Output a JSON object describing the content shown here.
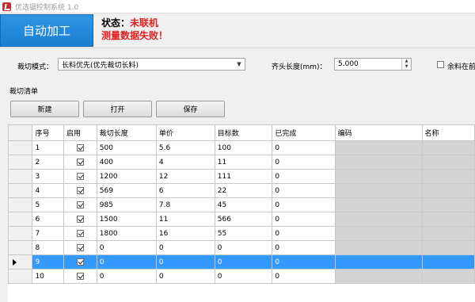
{
  "window": {
    "title": "优选锯控制系统 1.0"
  },
  "header": {
    "mode": "自动加工",
    "status_label": "状态：",
    "status_value": "未联机",
    "status_message": "测量数据失败！"
  },
  "config": {
    "cut_mode_label": "裁切模式：",
    "cut_mode_value": "长料优先(优先裁切长料)",
    "head_length_label": "齐头长度(mm)：",
    "head_length_value": "5.000",
    "remainder_label": "余料在前"
  },
  "cut_list": {
    "title": "裁切清单",
    "buttons": {
      "new": "新建",
      "open": "打开",
      "save": "保存"
    },
    "columns": [
      "序号",
      "启用",
      "裁切长度",
      "单价",
      "目标数",
      "已完成",
      "编码",
      "名称"
    ],
    "selected_index": 8,
    "rows": [
      {
        "seq": "1",
        "enabled": true,
        "length": "500",
        "price": "5.6",
        "target": "100",
        "done": "0",
        "code": "",
        "name": ""
      },
      {
        "seq": "2",
        "enabled": true,
        "length": "400",
        "price": "4",
        "target": "11",
        "done": "0",
        "code": "",
        "name": ""
      },
      {
        "seq": "3",
        "enabled": true,
        "length": "1200",
        "price": "12",
        "target": "111",
        "done": "0",
        "code": "",
        "name": ""
      },
      {
        "seq": "4",
        "enabled": true,
        "length": "569",
        "price": "6",
        "target": "22",
        "done": "0",
        "code": "",
        "name": ""
      },
      {
        "seq": "5",
        "enabled": true,
        "length": "985",
        "price": "7.8",
        "target": "45",
        "done": "0",
        "code": "",
        "name": ""
      },
      {
        "seq": "6",
        "enabled": true,
        "length": "1500",
        "price": "11",
        "target": "566",
        "done": "0",
        "code": "",
        "name": ""
      },
      {
        "seq": "7",
        "enabled": true,
        "length": "1800",
        "price": "16",
        "target": "55",
        "done": "0",
        "code": "",
        "name": ""
      },
      {
        "seq": "8",
        "enabled": true,
        "length": "0",
        "price": "0",
        "target": "0",
        "done": "0",
        "code": "",
        "name": ""
      },
      {
        "seq": "9",
        "enabled": true,
        "length": "0",
        "price": "0",
        "target": "0",
        "done": "0",
        "code": "",
        "name": ""
      },
      {
        "seq": "10",
        "enabled": true,
        "length": "0",
        "price": "0",
        "target": "0",
        "done": "0",
        "code": "",
        "name": ""
      }
    ]
  },
  "colors": {
    "banner": "#1a7fd3",
    "status_red": "#e0201f",
    "selection": "#3399ff",
    "readonly_cell": "#d3d3d3"
  }
}
